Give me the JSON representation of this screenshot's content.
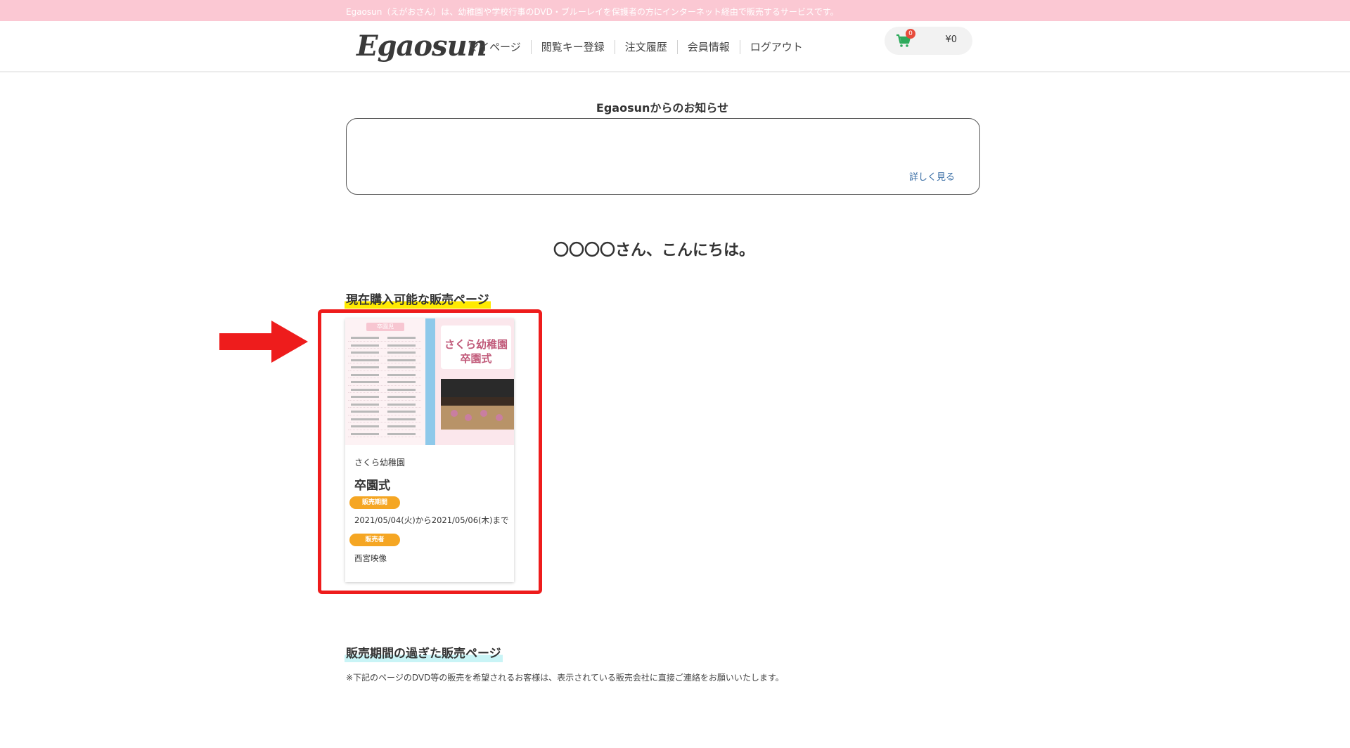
{
  "announce_bar": {
    "text": "Egaosun（えがおさん）は、幼稚園や学校行事のDVD・ブルーレイを保護者の方にインターネット経由で販売するサービスです。"
  },
  "header": {
    "logo": "Egaosun",
    "nav": [
      {
        "label": "マイページ"
      },
      {
        "label": "閲覧キー登録"
      },
      {
        "label": "注文履歴"
      },
      {
        "label": "会員情報"
      },
      {
        "label": "ログアウト"
      }
    ],
    "cart": {
      "count": "0",
      "total": "¥0",
      "icon": "cart-icon"
    }
  },
  "notice": {
    "title": "Egaosunからのお知らせ",
    "more_label": "詳しく見る"
  },
  "greeting": "〇〇〇〇さん、こんにちは。",
  "current_section": {
    "title": "現在購入可能な販売ページ",
    "cards": [
      {
        "thumb_tag": "卒園児",
        "thumb_kinder": "さくら幼稚園",
        "thumb_ceremony": "卒園式",
        "organization": "さくら幼稚園",
        "title": "卒園式",
        "period_label": "販売期間",
        "period": "2021/05/04(火)から2021/05/06(木)まで",
        "seller_label": "販売者",
        "seller": "西宮映像"
      }
    ]
  },
  "past_section": {
    "title": "販売期間の過ぎた販売ページ",
    "note": "※下記のページのDVD等の販売を希望されるお客様は、表示されている販売会社に直接ご連絡をお願いいたします。"
  },
  "colors": {
    "announce_bg": "#fbc8d3",
    "pill": "#f5a623",
    "highlight_yellow": "#ffea00",
    "highlight_cyan": "#c9f4f6",
    "annotation_red": "#ee1c1c",
    "cart_icon": "#2eaa5c"
  }
}
